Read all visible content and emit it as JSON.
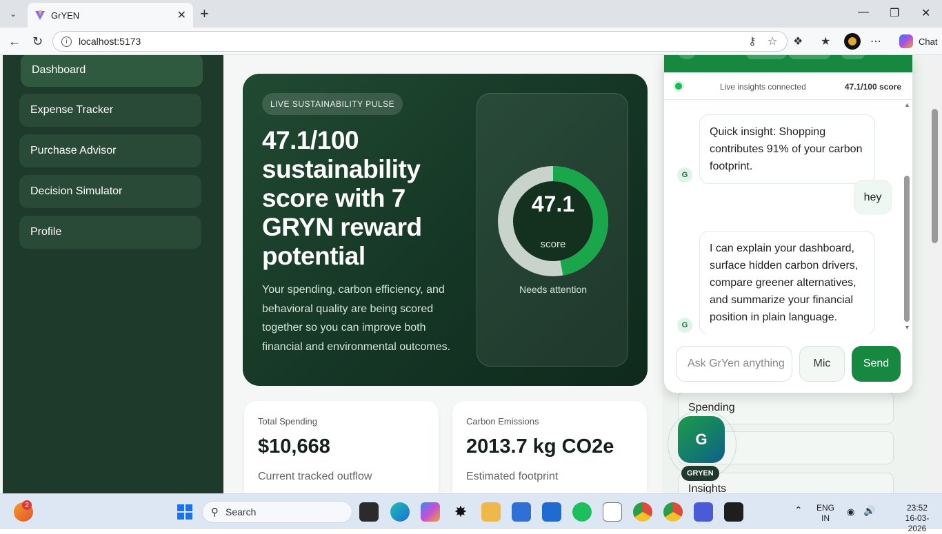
{
  "browser": {
    "tab_title": "GrYEN",
    "url": "localhost:5173",
    "chat_label": "Chat"
  },
  "sidebar": {
    "items": [
      {
        "label": "Dashboard",
        "active": true
      },
      {
        "label": "Expense Tracker"
      },
      {
        "label": "Purchase Advisor"
      },
      {
        "label": "Decision Simulator"
      },
      {
        "label": "Profile"
      }
    ]
  },
  "hero": {
    "pill": "LIVE SUSTAINABILITY PULSE",
    "title": "47.1/100 sustainability score with 7 GRYN reward potential",
    "description": "Your spending, carbon efficiency, and behavioral quality are being scored together so you can improve both financial and environmental outcomes.",
    "score_value": "47.1",
    "score_fraction": 0.471,
    "score_label": "score",
    "status": "Needs attention"
  },
  "stats": [
    {
      "label": "Total Spending",
      "value": "$10,668",
      "sub": "Current tracked outflow"
    },
    {
      "label": "Carbon Emissions",
      "value": "2013.7 kg CO2e",
      "sub": "Estimated footprint"
    }
  ],
  "right_panel": {
    "cards": [
      "Spending",
      "",
      "Insights"
    ]
  },
  "chat": {
    "connection": "Live insights connected",
    "score": "47.1/100 score",
    "avatar_letter": "G",
    "messages": [
      {
        "from": "bot",
        "text": "Quick insight: Shopping contributes 91% of your carbon footprint."
      },
      {
        "from": "user",
        "text": "hey"
      },
      {
        "from": "bot",
        "text": "I can explain your dashboard, surface hidden carbon drivers, compare greener alternatives, and summarize your financial position in plain language."
      }
    ],
    "input_placeholder": "Ask GrYen anything",
    "mic_label": "Mic",
    "send_label": "Send"
  },
  "launcher": {
    "letter": "G",
    "label": "GRYEN"
  },
  "taskbar": {
    "search_label": "Search",
    "notification_count": "2",
    "lang_top": "ENG",
    "lang_bottom": "IN",
    "time": "23:52",
    "date": "16-03-2026"
  },
  "colors": {
    "accent": "#16883f",
    "sidebar": "#1d3a2a",
    "hero_dark": "#143424"
  }
}
